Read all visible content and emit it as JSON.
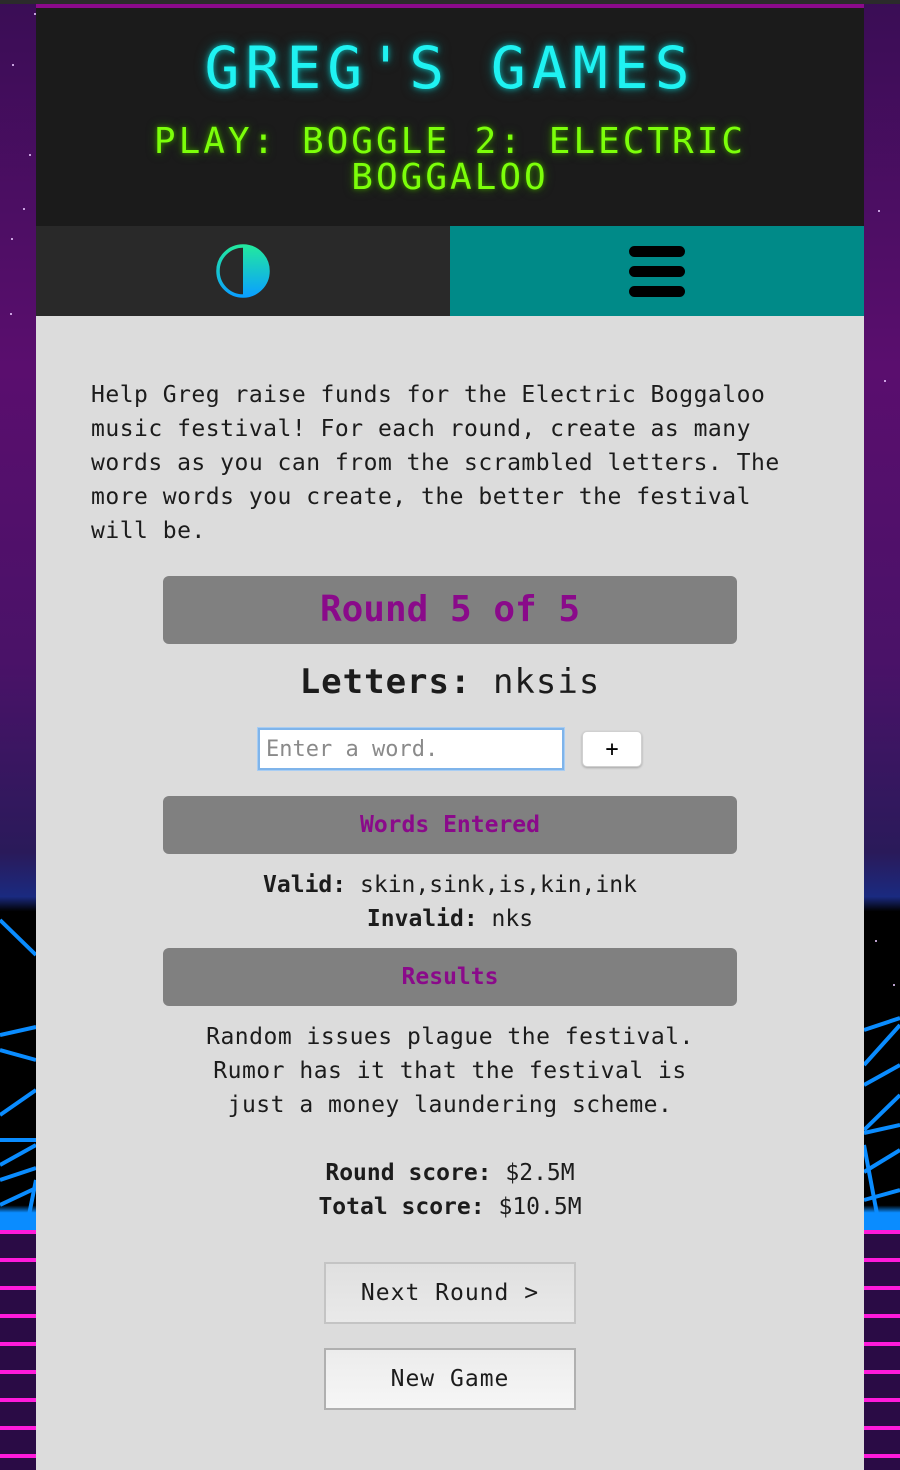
{
  "site": {
    "title": "GREG'S GAMES",
    "game_title_prefix": "Play: ",
    "game_title": "Boggle 2: Electric Boggaloo"
  },
  "nav": {
    "theme_toggle_icon": "contrast-half-circle-icon",
    "menu_icon": "hamburger-menu-icon"
  },
  "intro": "Help Greg raise funds for the Electric Boggaloo music festival! For each round, create as many words as you can from the scrambled letters. The more words you create, the better the festival will be.",
  "round": {
    "label": "Round 5 of 5",
    "current": 5,
    "total": 5
  },
  "letters": {
    "label": "Letters:",
    "value": "nksis"
  },
  "word_input": {
    "value": "",
    "placeholder": "Enter a word.",
    "add_label": "+"
  },
  "words_entered": {
    "heading": "Words Entered",
    "valid_label": "Valid:",
    "valid": "skin,sink,is,kin,ink",
    "invalid_label": "Invalid:",
    "invalid": "nks"
  },
  "results": {
    "heading": "Results",
    "text": "Random issues plague the festival. Rumor has it that the festival is just a money laundering scheme.",
    "round_score_label": "Round score:",
    "round_score": "$2.5M",
    "total_score_label": "Total score:",
    "total_score": "$10.5M"
  },
  "buttons": {
    "next_round": "Next Round >",
    "new_game": "New Game"
  },
  "colors": {
    "title_cyan": "#1ff2f2",
    "game_title_green": "#7cff0a",
    "accent_purple": "#8a0a8a",
    "menu_teal": "#008a88"
  }
}
